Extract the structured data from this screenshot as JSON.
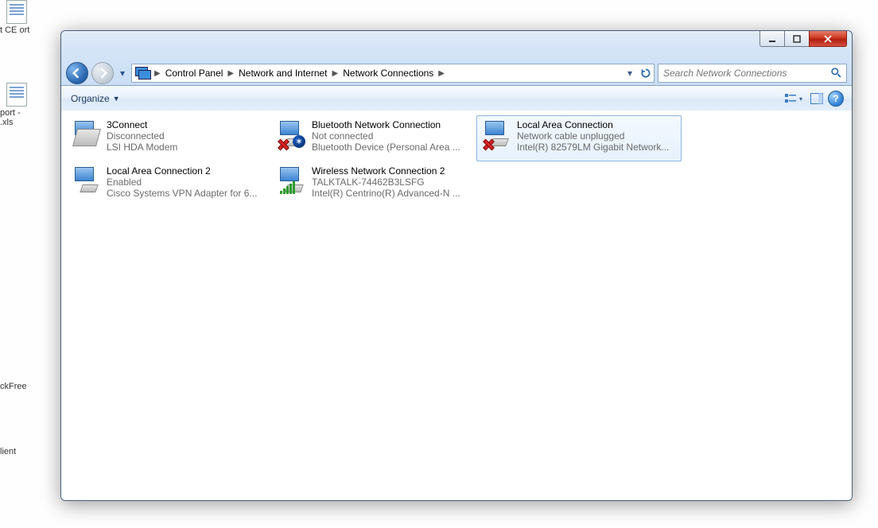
{
  "desktop": {
    "items": [
      {
        "label": "t CE\nort"
      },
      {
        "label": "port -\n.xls"
      },
      {
        "label": "ckFree"
      },
      {
        "label": "lient"
      }
    ]
  },
  "window": {
    "buttons": {
      "min": "–",
      "max": "□",
      "close": "✕"
    }
  },
  "breadcrumbs": {
    "items": [
      {
        "label": "Control Panel"
      },
      {
        "label": "Network and Internet"
      },
      {
        "label": "Network Connections"
      }
    ]
  },
  "search": {
    "placeholder": "Search Network Connections"
  },
  "toolbar": {
    "organize_label": "Organize"
  },
  "connections": [
    {
      "name": "3Connect",
      "status": "Disconnected",
      "device": "LSI HDA Modem",
      "icon": "modem",
      "selected": false
    },
    {
      "name": "Bluetooth Network Connection",
      "status": "Not connected",
      "device": "Bluetooth Device (Personal Area ...",
      "icon": "bluetooth",
      "overlay": "x",
      "selected": false
    },
    {
      "name": "Local Area Connection",
      "status": "Network cable unplugged",
      "device": "Intel(R) 82579LM Gigabit Network...",
      "icon": "nic",
      "overlay": "x",
      "selected": true
    },
    {
      "name": "Local Area Connection 2",
      "status": "Enabled",
      "device": "Cisco Systems VPN Adapter for 6...",
      "icon": "nic",
      "selected": false
    },
    {
      "name": "Wireless Network Connection 2",
      "status": "TALKTALK-74462B3LSFG",
      "device": "Intel(R) Centrino(R) Advanced-N ...",
      "icon": "wifi",
      "selected": false
    }
  ]
}
